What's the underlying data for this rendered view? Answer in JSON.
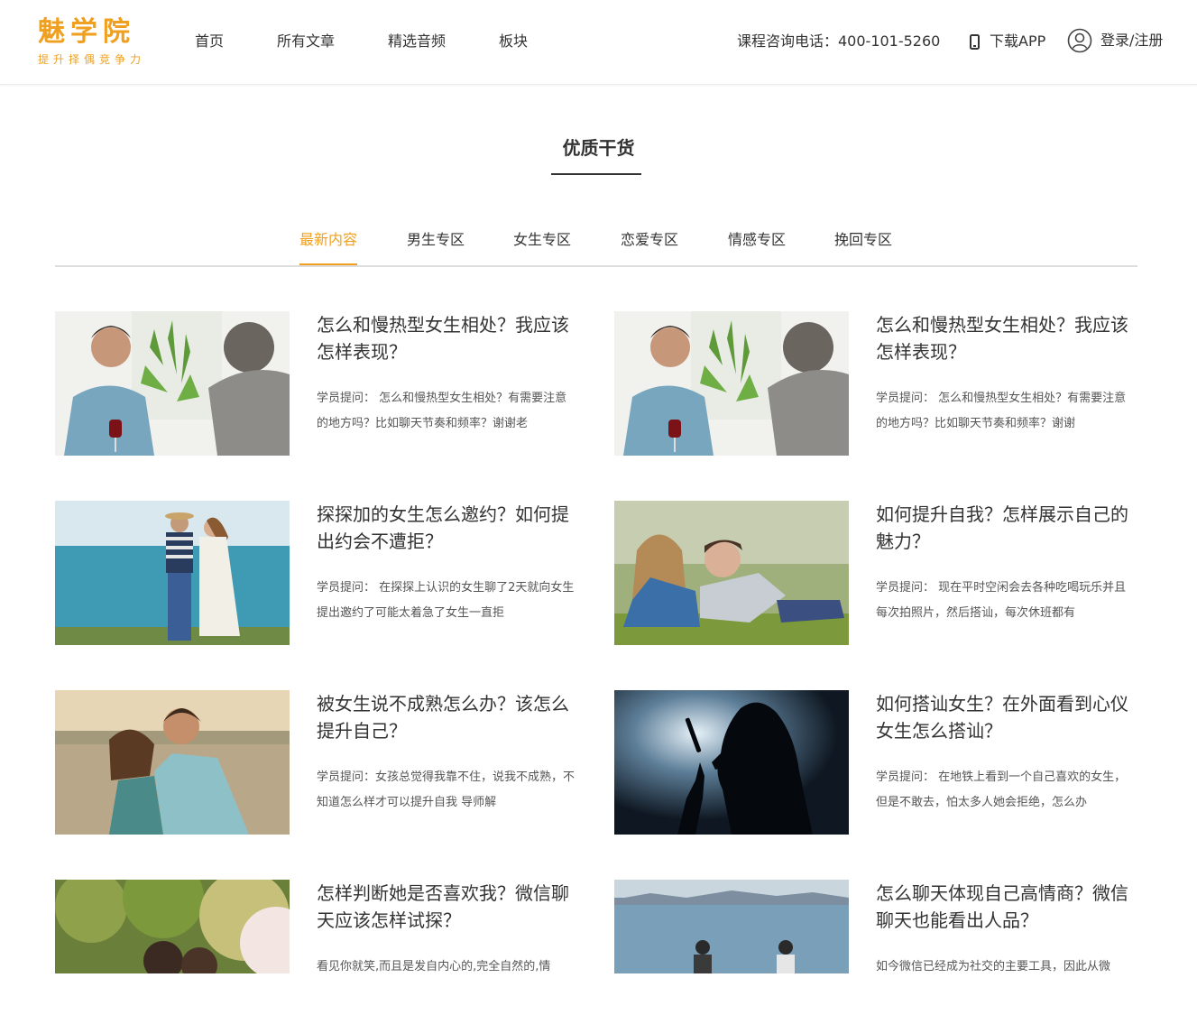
{
  "header": {
    "logo_name": "魅学院",
    "logo_slogan": "提升择偶竞争力",
    "nav": [
      "首页",
      "所有文章",
      "精选音频",
      "板块"
    ],
    "hotline": "课程咨询电话：400-101-5260",
    "app_label": "下载APP",
    "login_label": "登录/注册"
  },
  "section": {
    "title": "优质干货"
  },
  "tabs": {
    "items": [
      "最新内容",
      "男生专区",
      "女生专区",
      "恋爱专区",
      "情感专区",
      "挽回专区"
    ],
    "active_index": 0
  },
  "colors": {
    "brand": "#f0a020",
    "text": "#333333"
  },
  "articles": [
    {
      "title": "怎么和慢热型女生相处？我应该怎样表现？",
      "excerpt": "学员提问： 怎么和慢热型女生相处？有需要注意的地方吗？比如聊天节奏和频率？谢谢老"
    },
    {
      "title": "怎么和慢热型女生相处？我应该怎样表现？",
      "excerpt": "学员提问： 怎么和慢热型女生相处？有需要注意的地方吗？比如聊天节奏和频率？谢谢"
    },
    {
      "title": "探探加的女生怎么邀约？如何提出约会不遭拒？",
      "excerpt": "学员提问： 在探探上认识的女生聊了2天就向女生提出邀约了可能太着急了女生一直拒"
    },
    {
      "title": "如何提升自我？怎样展示自己的魅力？",
      "excerpt": "学员提问： 现在平时空闲会去各种吃喝玩乐并且每次拍照片，然后搭讪，每次休班都有"
    },
    {
      "title": "被女生说不成熟怎么办？该怎么提升自己？",
      "excerpt": "学员提问：女孩总觉得我靠不住，说我不成熟，不知道怎么样才可以提升自我 导师解"
    },
    {
      "title": "如何搭讪女生？在外面看到心仪女生怎么搭讪？",
      "excerpt": "学员提问： 在地铁上看到一个自己喜欢的女生，但是不敢去，怕太多人她会拒绝，怎么办"
    },
    {
      "title": "怎样判断她是否喜欢我？微信聊天应该怎样试探？",
      "excerpt": "看见你就笑,而且是发自内心的,完全自然的,情"
    },
    {
      "title": "怎么聊天体现自己高情商？微信聊天也能看出人品？",
      "excerpt": "如今微信已经成为社交的主要工具，因此从微"
    }
  ]
}
